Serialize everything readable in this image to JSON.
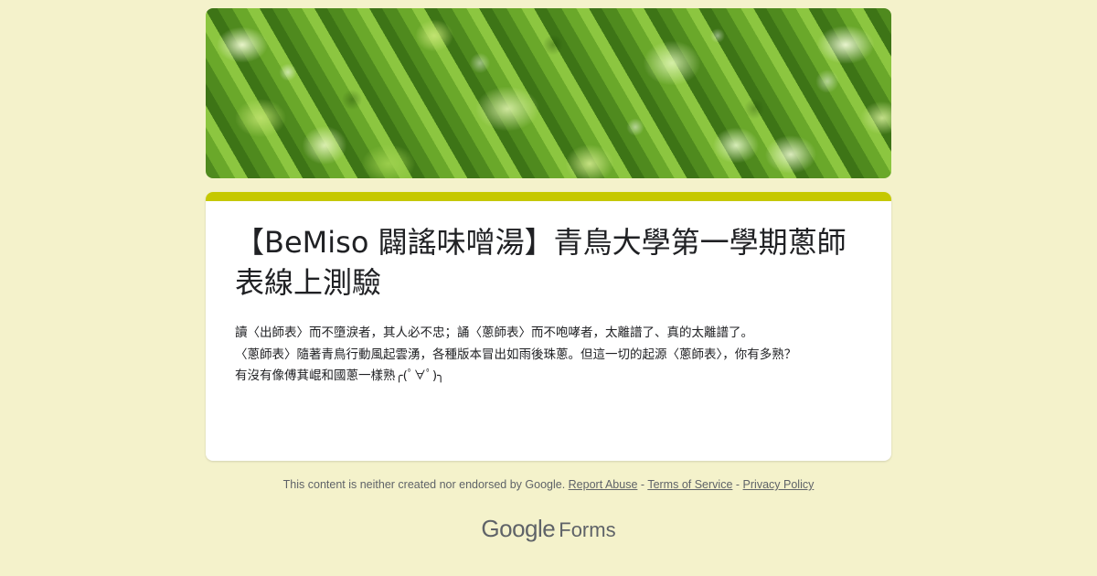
{
  "form": {
    "title": "【BeMiso 闢謠味噌湯】青鳥大學第一學期蔥師表線上測驗",
    "description": [
      "讀〈出師表〉而不墮淚者，其人必不忠；誦〈蔥師表〉而不咆哮者，太離譜了、真的太離譜了。",
      "〈蔥師表〉隨著青鳥行動風起雲湧，各種版本冒出如雨後珠蔥。但這一切的起源〈蔥師表〉，你有多熟？",
      "有沒有像傅萁崐和國蔥一樣熟╭(ﾟ∀ﾟ)╮"
    ]
  },
  "footer": {
    "notice": "This content is neither created nor endorsed by Google.",
    "report_abuse": "Report Abuse",
    "sep1": "-",
    "terms": "Terms of Service",
    "sep2": "-",
    "privacy": "Privacy Policy"
  },
  "brand": {
    "google": "Google",
    "forms": "Forms"
  },
  "colors": {
    "background": "#f4f2cb",
    "accent": "#c5c800"
  },
  "banner_image": "green-onion-photo"
}
